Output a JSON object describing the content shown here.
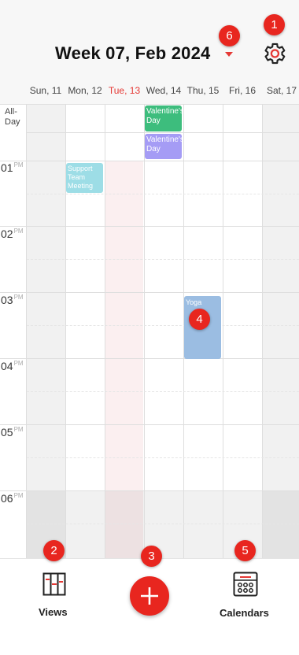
{
  "header": {
    "title": "Week 07, Feb 2024"
  },
  "days": [
    {
      "label": "Sun, 11",
      "today": false
    },
    {
      "label": "Mon, 12",
      "today": false
    },
    {
      "label": "Tue, 13",
      "today": true
    },
    {
      "label": "Wed, 14",
      "today": false
    },
    {
      "label": "Thu, 15",
      "today": false
    },
    {
      "label": "Fri, 16",
      "today": false
    },
    {
      "label": "Sat, 17",
      "today": false
    }
  ],
  "allday_label": "All-\nDay",
  "hours": [
    {
      "num": "01",
      "ampm": "PM"
    },
    {
      "num": "02",
      "ampm": "PM"
    },
    {
      "num": "03",
      "ampm": "PM"
    },
    {
      "num": "04",
      "ampm": "PM"
    },
    {
      "num": "05",
      "ampm": "PM"
    },
    {
      "num": "06",
      "ampm": "PM"
    }
  ],
  "events": {
    "valentines_1": "Valentine's Day",
    "valentines_2": "Valentine's Day",
    "support": "Support Team Meeting",
    "yoga": "Yoga"
  },
  "bottom_nav": {
    "views_label": "Views",
    "calendars_label": "Calendars"
  },
  "badges": [
    "1",
    "2",
    "3",
    "4",
    "5",
    "6"
  ],
  "colors": {
    "accent": "#e8261f",
    "valentine_green": "#3dbd7d",
    "valentine_purple": "#a59cf5",
    "support_teal": "#9ddde6",
    "yoga_blue": "#9bbde2",
    "today_tint": "#fbeaea"
  }
}
